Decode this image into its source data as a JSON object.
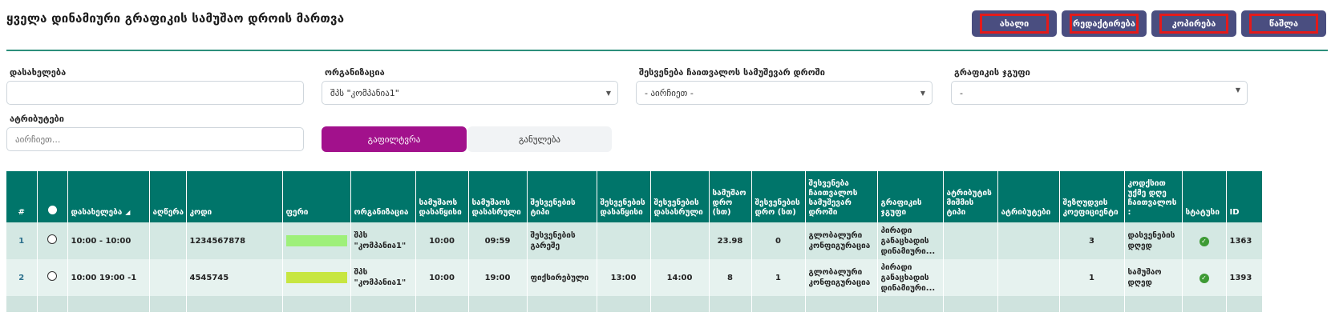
{
  "page_title": "ყველა დინამიური გრაფიკის სამუშაო დროის მართვა",
  "toolbar": {
    "new_label": "ახალი",
    "edit_label": "რედაქტირება",
    "copy_label": "კოპირება",
    "delete_label": "წაშლა"
  },
  "filters": {
    "name_label": "დასახელება",
    "name_value": "",
    "org_label": "ორგანიზაცია",
    "org_value": "შპს \"კომპანია1\"",
    "break_label": "შესვენება ჩაითვალოს სამუშევარ დროში",
    "break_value": "- აირჩიეთ -",
    "group_label": "გრაფიკის ჯგუფი",
    "group_value": "-",
    "attr_label": "ატრიბუტები",
    "attr_placeholder": "აირჩიეთ...",
    "filter_button": "გაფილტვრა",
    "reset_button": "განულება"
  },
  "table": {
    "headers": {
      "num": "#",
      "name": "დასახელება",
      "accounting": "აღწერა",
      "code": "კოდი",
      "color": "ფერი",
      "org": "ორგანიზაცია",
      "work_start": "სამუშაოს დასაწყისი",
      "work_end": "სამუშაოს დასასრული",
      "break_type": "შესვენების ტიპი",
      "break_start": "შესვენების დასაწყისი",
      "break_end": "შესვენების დასასრული",
      "work_time": "სამუშაო დრო (სთ)",
      "break_time": "შესვენების დრო (სთ)",
      "break_counted": "შესვენება ჩაითვალოს სამუშევარ დროში",
      "schedule_group": "გრაფიკის ჯგუფი",
      "attr_value_type": "ატრიბუტის მიშმის ტიპი",
      "attributes": "ატრიბუტები",
      "coef": "შეზღუდვის კოეფიციენტი",
      "code_next_day": "კოდქსით უქმე დღე ჩაითვალოს :",
      "status": "სტატუსი",
      "id": "ID"
    },
    "rows": [
      {
        "num": "1",
        "name": "10:00 - 10:00",
        "accounting": "",
        "code": "1234567878",
        "color": "#9ef07a",
        "org": "შპს \"კომპანია1\"",
        "work_start": "10:00",
        "work_end": "09:59",
        "break_type": "შესვენების გარეშე",
        "break_start": "",
        "break_end": "",
        "work_time": "23.98",
        "break_time": "0",
        "break_counted": "გლობალური კონფიგურაცია",
        "schedule_group": "პირადი განაცხადის დინამიური...",
        "attr_value_type": "",
        "attributes": "",
        "coef": "3",
        "code_next_day": "დასვენების დღედ",
        "id": "1363"
      },
      {
        "num": "2",
        "name": "10:00 19:00 -1",
        "accounting": "",
        "code": "4545745",
        "color": "#c7e641",
        "org": "შპს \"კომპანია1\"",
        "work_start": "10:00",
        "work_end": "19:00",
        "break_type": "ფიქსირებული",
        "break_start": "13:00",
        "break_end": "14:00",
        "work_time": "8",
        "break_time": "1",
        "break_counted": "გლობალური კონფიგურაცია",
        "schedule_group": "პირადი განაცხადის დინამიური...",
        "attr_value_type": "",
        "attributes": "",
        "coef": "1",
        "code_next_day": "სამუშაო დღედ",
        "id": "1393"
      }
    ]
  }
}
